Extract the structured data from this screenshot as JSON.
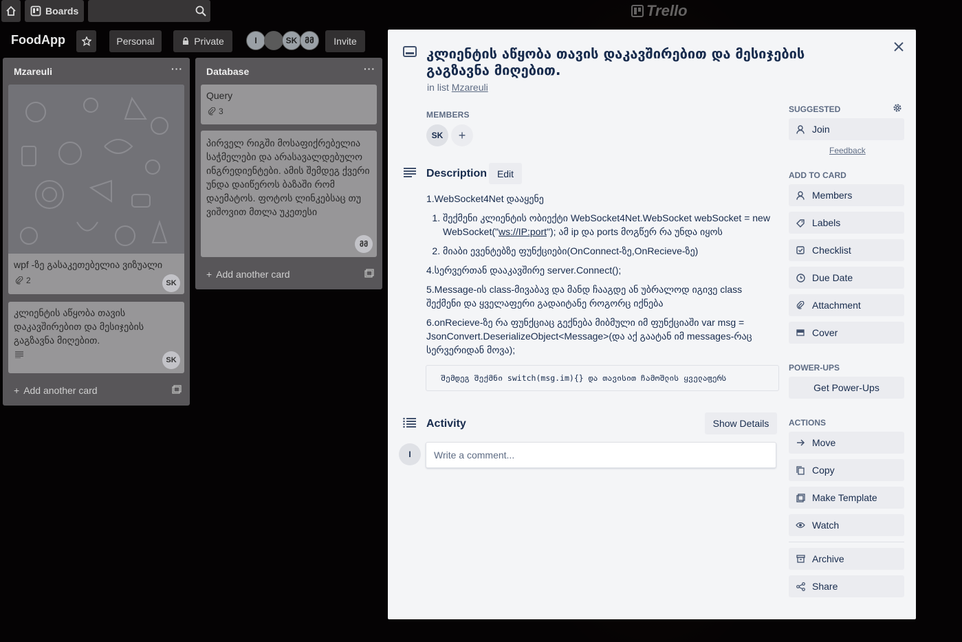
{
  "header": {
    "boards_label": "Boards",
    "logo_text": "Trello"
  },
  "board": {
    "title": "FoodApp",
    "personal_label": "Personal",
    "private_label": "Private",
    "invite_label": "Invite",
    "members": [
      "I",
      "",
      "SK",
      "მმ"
    ]
  },
  "lists": [
    {
      "title": "Mzareuli",
      "cards": [
        {
          "text": "wpf -ზე გასაკეთებელია ვიზუალი",
          "attachments": "2",
          "member": "SK"
        },
        {
          "text": "კლიენტის აწყობა თავის დაკავშირებით და მესიჯების გაგზავნა მიღებით.",
          "member": "SK"
        }
      ],
      "add_label": "Add another card"
    },
    {
      "title": "Database",
      "cards": [
        {
          "text": "Query",
          "attachments": "3"
        },
        {
          "text": "პირველ რიგში მოსაფიქრებელია საჭმელები და არასავალდებულო ინგრედიენტები. ამის შემდეგ ქვერი უნდა დაიწეროს ბაზაში რომ დაემატოს. ფოტოს ლინკებსაც თუ ვიშოვით მთლა უკეთესი",
          "member": "მმ"
        }
      ],
      "add_label": "Add another card"
    }
  ],
  "modal": {
    "title": "კლიენტის აწყობა თავის დაკავშირებით და მესიჯების გაგზავნა მიღებით.",
    "in_list_prefix": "in list",
    "in_list_name": "Mzareuli",
    "members_label": "Members",
    "member_initials": "SK",
    "description_label": "Description",
    "edit_label": "Edit",
    "description": {
      "line1": "1.WebSocket4Net დააყენე",
      "sub1_a": "შექმენი კლიენტის ობიექტი WebSocket4Net.WebSocket webSocket = new WebSocket(\"",
      "sub1_link": "ws://IP:port",
      "sub1_b": "\"); ამ ip და ports მოგწერ რა უნდა იყოს",
      "sub2": "მიაბი ევენტებზე ფუნქციები(OnConnect-ზე,OnRecieve-ზე)",
      "line4": "4.სერვერთან დააკავშირე server.Connect();",
      "line5": "5.Message-ის class-მივაბავ და მანდ ჩააგდე ან უბრალოდ იგივე class შექმენი და ყველაფერი გადაიტანე როგორც იქნება",
      "line6": "6.onRecieve-ზე რა ფუნქციაც გექნება მიბმული იმ ფუნქციაში var msg = JsonConvert.DeserializeObject<Message>(და აქ გაატან იმ messages-რაც სერვერიდან მოვა);",
      "code": "შემდეგ შექმნი switch(msg.im){} და თავისით ჩამოშლის ყველაფერს"
    },
    "activity_label": "Activity",
    "show_details_label": "Show Details",
    "comment_avatar": "I",
    "comment_placeholder": "Write a comment..."
  },
  "sidebar": {
    "suggested_label": "Suggested",
    "join_label": "Join",
    "feedback_label": "Feedback",
    "add_to_card_label": "Add to card",
    "add_to_card": [
      "Members",
      "Labels",
      "Checklist",
      "Due Date",
      "Attachment",
      "Cover"
    ],
    "powerups_label": "Power-Ups",
    "get_powerups_label": "Get Power-Ups",
    "actions_label": "Actions",
    "actions": [
      "Move",
      "Copy",
      "Make Template",
      "Watch"
    ],
    "archive_label": "Archive",
    "share_label": "Share"
  },
  "colors": {
    "modal_bg": "#f4f5f7",
    "button_bg": "#ebecf0",
    "text": "#172b4d",
    "muted": "#5e6c84"
  }
}
